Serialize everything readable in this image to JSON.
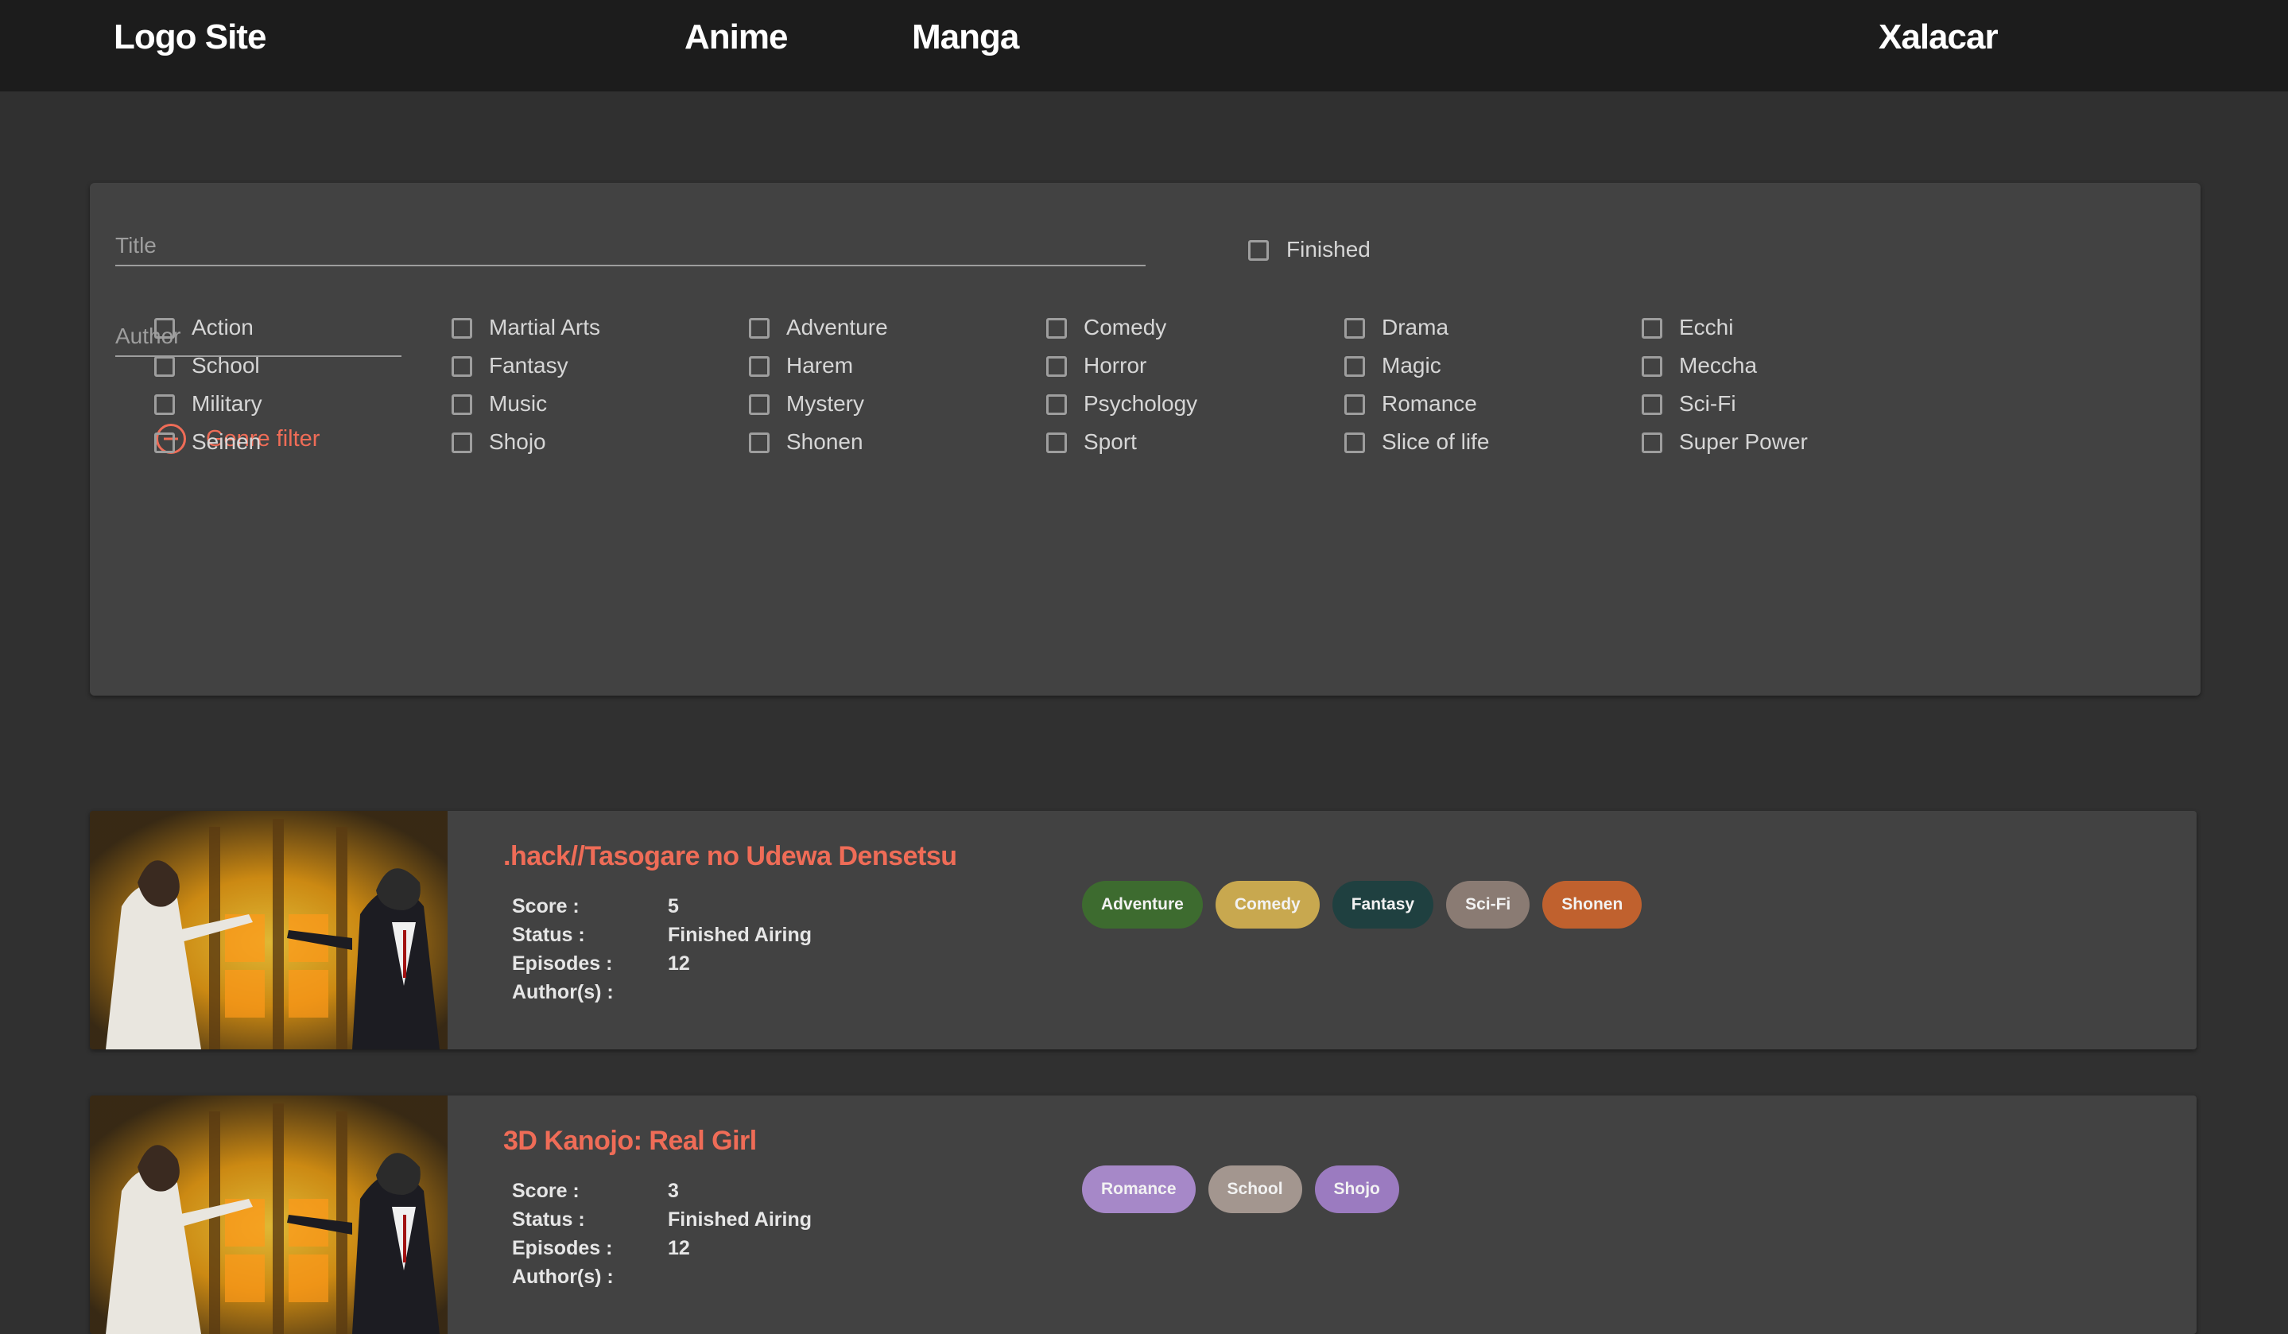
{
  "nav": {
    "logo": "Logo Site",
    "links": [
      "Anime",
      "Manga"
    ],
    "user": "Xalacar"
  },
  "filters": {
    "title_placeholder": "Title",
    "author_placeholder": "Author",
    "finished_label": "Finished",
    "genre_toggle_label": "Genre filter",
    "genre_columns": [
      [
        "Action",
        "School",
        "Military",
        "Seinen"
      ],
      [
        "Martial Arts",
        "Fantasy",
        "Music",
        "Shojo"
      ],
      [
        "Adventure",
        "Harem",
        "Mystery",
        "Shonen"
      ],
      [
        "Comedy",
        "Horror",
        "Psychology",
        "Sport"
      ],
      [
        "Drama",
        "Magic",
        "Romance",
        "Slice of life"
      ],
      [
        "Ecchi",
        "Meccha",
        "Sci-Fi",
        "Super Power"
      ]
    ]
  },
  "meta_labels": {
    "score": "Score :",
    "status": "Status :",
    "episodes": "Episodes :",
    "authors": "Author(s) :"
  },
  "results": [
    {
      "title": ".hack//Tasogare no Udewa Densetsu",
      "score": "5",
      "status": "Finished Airing",
      "episodes": "12",
      "authors": "",
      "genres": [
        {
          "label": "Adventure",
          "color": "#3d6b2f"
        },
        {
          "label": "Comedy",
          "color": "#c8a84f"
        },
        {
          "label": "Fantasy",
          "color": "#1f4040"
        },
        {
          "label": "Sci-Fi",
          "color": "#8a7b73"
        },
        {
          "label": "Shonen",
          "color": "#c0612e"
        }
      ]
    },
    {
      "title": "3D Kanojo: Real Girl",
      "score": "3",
      "status": "Finished Airing",
      "episodes": "12",
      "authors": "",
      "genres": [
        {
          "label": "Romance",
          "color": "#a688c8"
        },
        {
          "label": "School",
          "color": "#a3968f"
        },
        {
          "label": "Shojo",
          "color": "#9b7bc0"
        }
      ]
    }
  ],
  "colors": {
    "accent": "#ef6c57",
    "navbar": "#1c1c1c",
    "background": "#303030",
    "card": "#424242"
  }
}
